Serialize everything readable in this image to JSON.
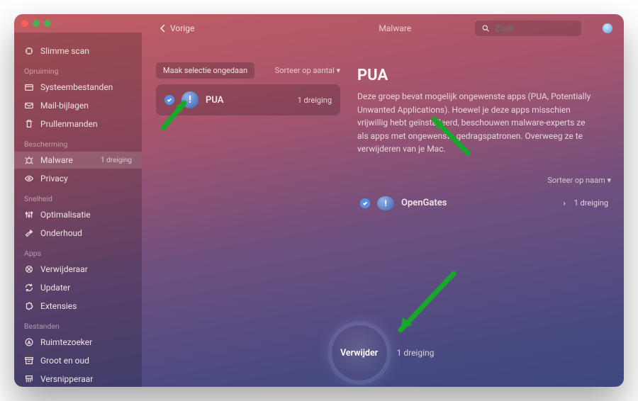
{
  "titlebar": {
    "back_label": "Vorige",
    "breadcrumb": "Malware",
    "search_placeholder": "Zoek"
  },
  "sidebar": {
    "top_item": "Slimme scan",
    "sections": [
      {
        "title": "Opruiming",
        "items": [
          {
            "label": "Systeembestanden",
            "icon": "box"
          },
          {
            "label": "Mail-bijlagen",
            "icon": "mail"
          },
          {
            "label": "Prullenmanden",
            "icon": "trash"
          }
        ]
      },
      {
        "title": "Bescherming",
        "items": [
          {
            "label": "Malware",
            "icon": "bug",
            "badge": "1 dreiging",
            "active": true
          },
          {
            "label": "Privacy",
            "icon": "eye"
          }
        ]
      },
      {
        "title": "Snelheid",
        "items": [
          {
            "label": "Optimalisatie",
            "icon": "sliders"
          },
          {
            "label": "Onderhoud",
            "icon": "wrench"
          }
        ]
      },
      {
        "title": "Apps",
        "items": [
          {
            "label": "Verwijderaar",
            "icon": "uninstall"
          },
          {
            "label": "Updater",
            "icon": "refresh"
          },
          {
            "label": "Extensies",
            "icon": "puzzle"
          }
        ]
      },
      {
        "title": "Bestanden",
        "items": [
          {
            "label": "Ruimtezoeker",
            "icon": "compass"
          },
          {
            "label": "Groot en oud",
            "icon": "archive"
          },
          {
            "label": "Versnipperaar",
            "icon": "shred"
          }
        ]
      }
    ]
  },
  "left_col": {
    "deselect_label": "Maak selectie ongedaan",
    "sort_label": "Sorteer op aantal ▾",
    "group": {
      "name": "PUA",
      "count_label": "1 dreiging"
    }
  },
  "right_col": {
    "title": "PUA",
    "description": "Deze groep bevat mogelijk ongewenste apps (PUA, Potentially Unwanted Applications). Hoewel je deze apps misschien vrijwillig hebt geïnstalleerd, beschouwen malware-experts ze als apps met ongewenste gedragspatronen. Overweeg ze te verwijderen van je Mac.",
    "sort_label": "Sorteer op naam ▾",
    "detection": {
      "name": "OpenGates",
      "count_label": "1 dreiging"
    }
  },
  "footer": {
    "button_label": "Verwijder",
    "count_label": "1 dreiging"
  }
}
